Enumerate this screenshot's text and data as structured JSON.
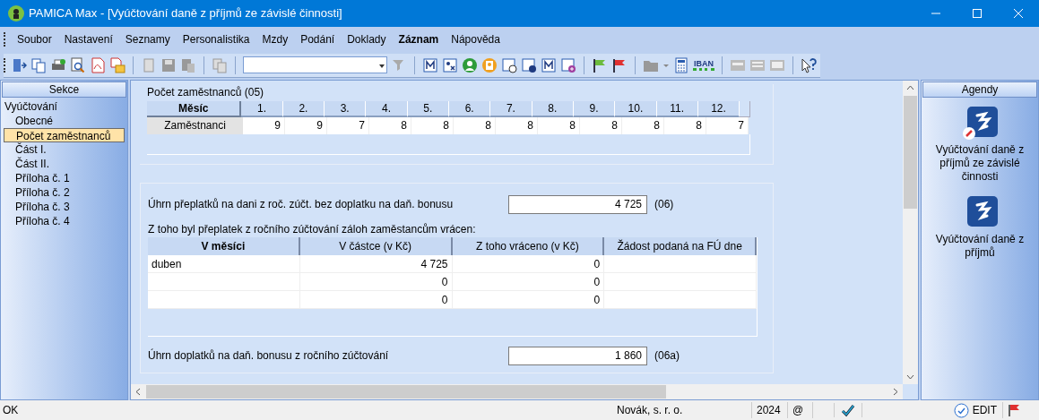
{
  "window": {
    "title": "PAMICA Max - [Vyúčtování daně z příjmů ze závislé činnosti]"
  },
  "menu": [
    {
      "label": "Soubor",
      "bold": false
    },
    {
      "label": "Nastavení",
      "bold": false
    },
    {
      "label": "Seznamy",
      "bold": false
    },
    {
      "label": "Personalistika",
      "bold": false
    },
    {
      "label": "Mzdy",
      "bold": false
    },
    {
      "label": "Podání",
      "bold": false
    },
    {
      "label": "Doklady",
      "bold": false
    },
    {
      "label": "Záznam",
      "bold": true
    },
    {
      "label": "Nápověda",
      "bold": false
    }
  ],
  "toolbar": {
    "iban_label": "IBAN"
  },
  "sidebar": {
    "title": "Sekce",
    "items": [
      {
        "label": "Vyúčtování",
        "selected": false,
        "children": [
          {
            "label": "Obecné",
            "selected": false
          },
          {
            "label": "Počet zaměstnanců",
            "selected": true
          },
          {
            "label": "Část I.",
            "selected": false
          },
          {
            "label": "Část II.",
            "selected": false
          },
          {
            "label": "Příloha č. 1",
            "selected": false
          },
          {
            "label": "Příloha č. 2",
            "selected": false
          },
          {
            "label": "Příloha č. 3",
            "selected": false
          },
          {
            "label": "Příloha č. 4",
            "selected": false
          }
        ]
      }
    ]
  },
  "employees": {
    "title": "Počet zaměstnanců (05)",
    "header": "Měsíc",
    "months": [
      "1.",
      "2.",
      "3.",
      "4.",
      "5.",
      "6.",
      "7.",
      "8.",
      "9.",
      "10.",
      "11.",
      "12."
    ],
    "row_label": "Zaměstnanci",
    "values": [
      "9",
      "9",
      "7",
      "8",
      "8",
      "8",
      "8",
      "8",
      "8",
      "8",
      "8",
      "7"
    ]
  },
  "overpayment": {
    "label": "Úhrn přeplatků na dani z roč. zúčt. bez doplatku na daň. bonusu",
    "value": "4 725",
    "code": "(06)"
  },
  "refunds": {
    "label": "Z toho byl přeplatek z ročního zúčtování záloh zaměstancům vrácen:",
    "columns": [
      "V měsíci",
      "V částce (v Kč)",
      "Z toho vráceno (v Kč)",
      "Žádost podaná na FÚ dne"
    ],
    "rows": [
      [
        "duben",
        "4 725",
        "0",
        ""
      ],
      [
        "",
        "0",
        "0",
        ""
      ],
      [
        "",
        "0",
        "0",
        ""
      ]
    ]
  },
  "bonus": {
    "label": "Úhrn doplatků na daň. bonusu z ročního zúčtování",
    "value": "1 860",
    "code": "(06a)"
  },
  "agendas": {
    "title": "Agendy",
    "items": [
      {
        "label": "Vyúčtování daně z příjmů ze závislé činnosti",
        "edited": true
      },
      {
        "label": "Vyúčtování daně z příjmů",
        "edited": false
      }
    ]
  },
  "status_bar": {
    "message": "OK",
    "company": "Novák, s. r. o.",
    "year": "2024",
    "at": "@",
    "mode": "EDIT"
  }
}
